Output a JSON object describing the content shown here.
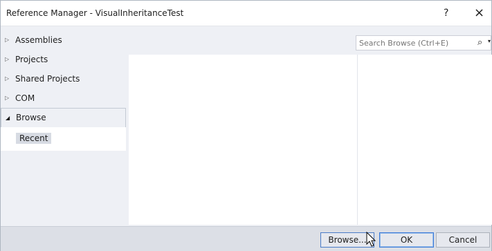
{
  "window": {
    "title": "Reference Manager - VisualInheritanceTest",
    "help": "?",
    "close": "×"
  },
  "nav": {
    "items": [
      {
        "label": "Assemblies",
        "expanded": false
      },
      {
        "label": "Projects",
        "expanded": false
      },
      {
        "label": "Shared Projects",
        "expanded": false
      },
      {
        "label": "COM",
        "expanded": false
      },
      {
        "label": "Browse",
        "expanded": true
      }
    ],
    "sub_item": "Recent",
    "collapsed_glyph": "▷",
    "expanded_glyph": "◢"
  },
  "search": {
    "placeholder": "Search Browse (Ctrl+E)",
    "icon": "search-icon"
  },
  "footer": {
    "browse_label": "Browse...",
    "ok_label": "OK",
    "cancel_label": "Cancel"
  },
  "colors": {
    "accent": "#3b7ad9",
    "panel": "#eef0f5",
    "footer": "#dcdfe6"
  }
}
